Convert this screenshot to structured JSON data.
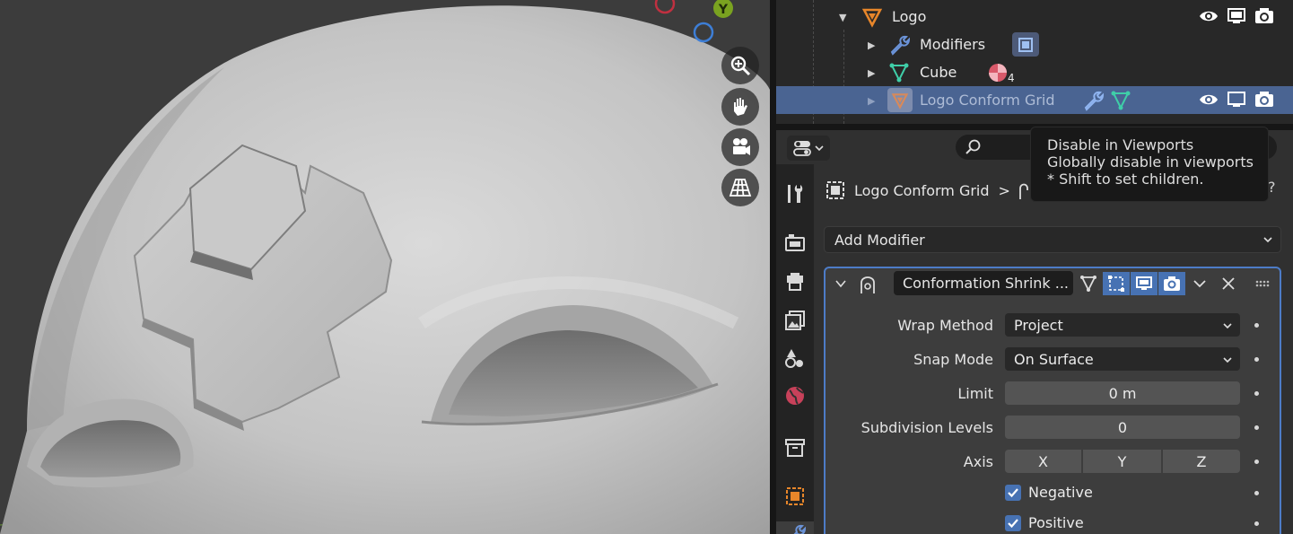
{
  "viewport": {
    "navigation": [
      {
        "icon": "zoom-icon"
      },
      {
        "icon": "hand-pan-icon"
      },
      {
        "icon": "camera-view-icon"
      },
      {
        "icon": "perspective-grid-icon"
      }
    ],
    "gizmo": {
      "y_label": "Y"
    }
  },
  "outliner": {
    "rows": [
      {
        "label": "Logo",
        "icon": "logo-object-icon"
      },
      {
        "label": "Modifiers",
        "icon": "wrench-icon"
      },
      {
        "label": "Cube",
        "icon": "mesh-icon",
        "material_count": "4"
      },
      {
        "label": "Logo Conform Grid",
        "icon": "logo-object-icon",
        "selected": true
      }
    ]
  },
  "tooltip": {
    "title": "Disable in Viewports",
    "description": "Globally disable in viewports",
    "hint": "* Shift to set children."
  },
  "properties": {
    "breadcrumb": {
      "object": "Logo Conform Grid",
      "separator": ">"
    },
    "add_modifier": "Add Modifier",
    "modifier": {
      "name": "Conformation Shrink ...",
      "fields": {
        "wrap_method": {
          "label": "Wrap Method",
          "value": "Project"
        },
        "snap_mode": {
          "label": "Snap Mode",
          "value": "On Surface"
        },
        "limit": {
          "label": "Limit",
          "value": "0 m"
        },
        "subdivision_levels": {
          "label": "Subdivision Levels",
          "value": "0"
        },
        "axis": {
          "label": "Axis",
          "options": [
            "X",
            "Y",
            "Z"
          ]
        }
      },
      "checkboxes": [
        {
          "label": "Negative",
          "checked": true
        },
        {
          "label": "Positive",
          "checked": true
        }
      ]
    }
  },
  "colors": {
    "accent": "#4772b3",
    "selection": "#4a6492",
    "orange": "#e8862a",
    "mesh_green": "#3fcea8",
    "modifier_blue": "#6b93d8"
  }
}
